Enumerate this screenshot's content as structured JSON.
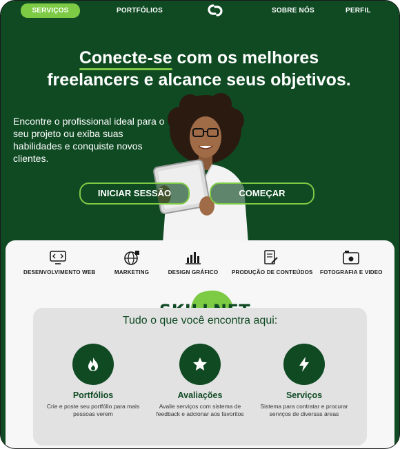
{
  "nav": {
    "items": [
      {
        "label": "SERVIÇOS",
        "active": true
      },
      {
        "label": "PORTFÓLIOS",
        "active": false
      },
      {
        "label": "SOBRE NÓS",
        "active": false
      },
      {
        "label": "PERFIL",
        "active": false
      }
    ],
    "logo_icon": "link-logo-icon"
  },
  "hero": {
    "headline_accent": "Conecte-se",
    "headline_rest": " com os melhores",
    "headline_line2": "freelancers e alcance seus objetivos.",
    "subtext": "Encontre o profissional ideal para o seu projeto ou exiba suas habilidades e conquiste novos clientes.",
    "login_button": "INICIAR SESSÃO",
    "start_button": "COMEÇAR"
  },
  "categories": [
    {
      "label": "DESENVOLVIMENTO WEB",
      "icon": "monitor-code-icon"
    },
    {
      "label": "MARKETING",
      "icon": "globe-icon"
    },
    {
      "label": "DESIGN GRÁFICO",
      "icon": "bar-chart-icon"
    },
    {
      "label": "PRODUÇÃO DE CONTEÚDOS",
      "icon": "document-pen-icon"
    },
    {
      "label": "FOTOGRAFIA E VIDEO",
      "icon": "camera-icon"
    }
  ],
  "brand": {
    "name": "SKILLNET"
  },
  "features": {
    "title": "Tudo o que você encontra aqui:",
    "items": [
      {
        "title": "Portfólios",
        "desc": "Crie e poste seu portfólio para mais pessoas verem",
        "icon": "flame-icon"
      },
      {
        "title": "Avaliações",
        "desc": "Avalie serviços com sistema de feedback e adcionar aos favoritos",
        "icon": "star-icon"
      },
      {
        "title": "Serviços",
        "desc": "Sistema para contratar e procurar serviços de diversas áreas",
        "icon": "lightning-icon"
      }
    ]
  },
  "colors": {
    "primary": "#0f4a23",
    "accent": "#7dca45",
    "panel": "#f7f7f7",
    "card": "#e2e2e2"
  }
}
